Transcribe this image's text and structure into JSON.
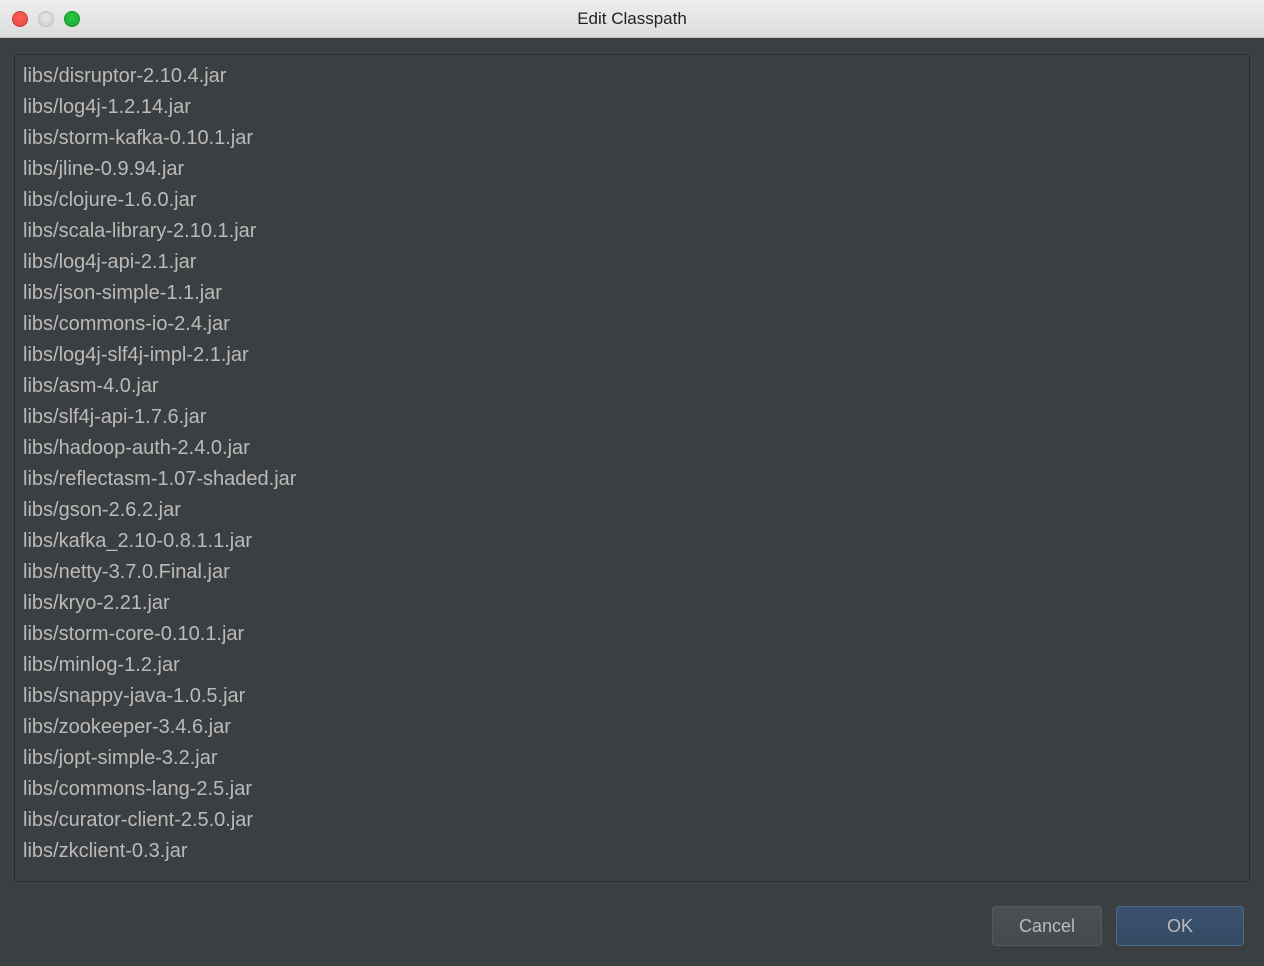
{
  "window": {
    "title": "Edit Classpath"
  },
  "classpath": {
    "items": [
      "libs/disruptor-2.10.4.jar",
      "libs/log4j-1.2.14.jar",
      "libs/storm-kafka-0.10.1.jar",
      "libs/jline-0.9.94.jar",
      "libs/clojure-1.6.0.jar",
      "libs/scala-library-2.10.1.jar",
      "libs/log4j-api-2.1.jar",
      "libs/json-simple-1.1.jar",
      "libs/commons-io-2.4.jar",
      "libs/log4j-slf4j-impl-2.1.jar",
      "libs/asm-4.0.jar",
      "libs/slf4j-api-1.7.6.jar",
      "libs/hadoop-auth-2.4.0.jar",
      "libs/reflectasm-1.07-shaded.jar",
      "libs/gson-2.6.2.jar",
      "libs/kafka_2.10-0.8.1.1.jar",
      "libs/netty-3.7.0.Final.jar",
      "libs/kryo-2.21.jar",
      "libs/storm-core-0.10.1.jar",
      "libs/minlog-1.2.jar",
      "libs/snappy-java-1.0.5.jar",
      "libs/zookeeper-3.4.6.jar",
      "libs/jopt-simple-3.2.jar",
      "libs/commons-lang-2.5.jar",
      "libs/curator-client-2.5.0.jar",
      "libs/zkclient-0.3.jar"
    ]
  },
  "buttons": {
    "cancel_label": "Cancel",
    "ok_label": "OK"
  }
}
